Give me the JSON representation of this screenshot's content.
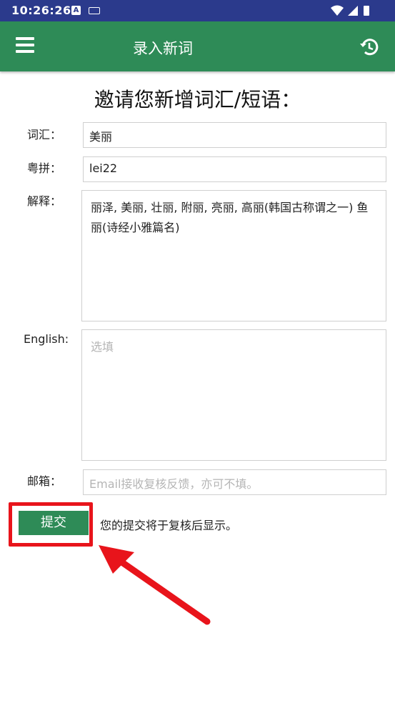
{
  "status_bar": {
    "time": "10:26:26",
    "a_badge": "A"
  },
  "app_bar": {
    "title": "录入新词"
  },
  "form": {
    "heading": "邀请您新增词汇/短语：",
    "word": {
      "label": "词汇：",
      "value": "美丽"
    },
    "jyutping": {
      "label": "粤拼：",
      "value": "lei22"
    },
    "explanation": {
      "label": "解释：",
      "value": "丽泽, 美丽, 壮丽, 附丽, 亮丽, 高丽(韩国古称谓之一) 鱼丽(诗经小雅篇名)"
    },
    "english": {
      "label": "English:",
      "placeholder": "选填"
    },
    "email": {
      "label": "邮箱：",
      "placeholder": "Email接收复核反馈，亦可不填。"
    },
    "submit_label": "提交",
    "submit_note": "您的提交将于复核后显示。"
  },
  "colors": {
    "status_bar": "#2b3a8c",
    "app_bar": "#2e8b57",
    "highlight": "#e8141b"
  }
}
